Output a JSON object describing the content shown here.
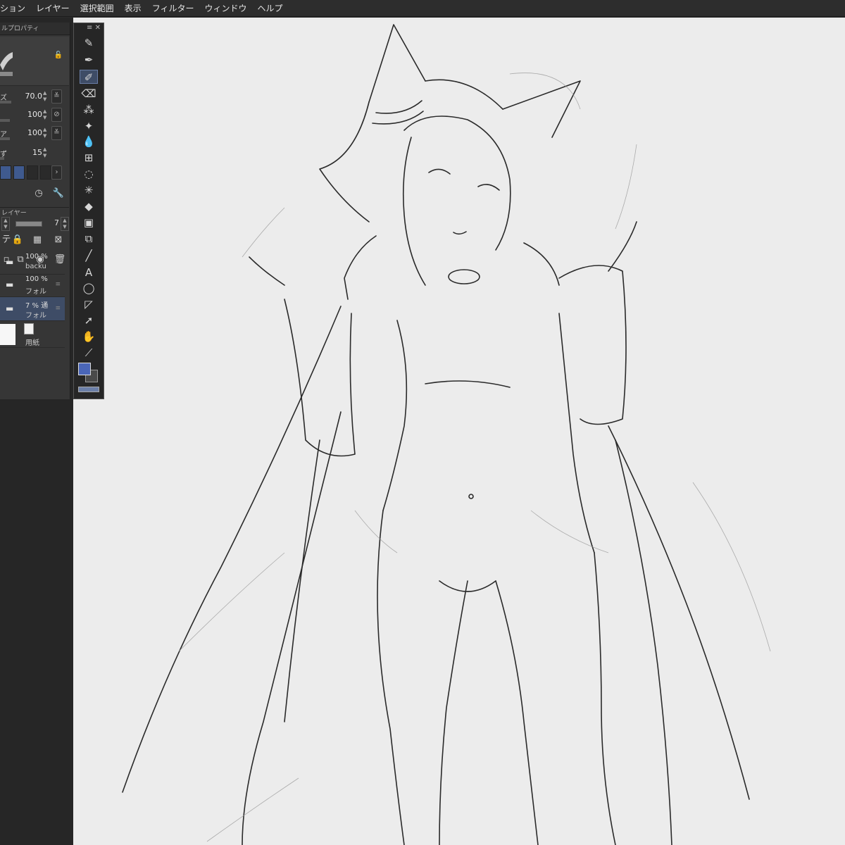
{
  "menu": {
    "items": [
      "ション",
      "レイヤー",
      "選択範囲",
      "表示",
      "フィルター",
      "ウィンドウ",
      "ヘルプ"
    ]
  },
  "tool_property": {
    "title": "ルプロパティ",
    "rows": [
      {
        "label": "ズ",
        "value": "70.0"
      },
      {
        "label": "",
        "value": "100"
      },
      {
        "label": "",
        "value": "100"
      },
      {
        "label": "",
        "value": "15"
      }
    ],
    "swatch_colors": [
      "#3f5a8f",
      "#3f5a8f",
      "#2a2a2a",
      "#2a2a2a"
    ]
  },
  "layer_panel": {
    "title": "レイヤー",
    "opacity_value": "7",
    "layers": [
      {
        "percent": "100 %",
        "name": "backup",
        "type": "folder",
        "selected": false
      },
      {
        "percent": "100 %",
        "name": "フォルダ",
        "type": "folder",
        "selected": false
      },
      {
        "percent": "7 % 通",
        "name": "フォルダ",
        "type": "folder",
        "selected": true
      }
    ],
    "paper": {
      "name": "用紙"
    }
  },
  "toolbar": {
    "tools": [
      {
        "name": "pencil",
        "glyph": "✎"
      },
      {
        "name": "pen",
        "glyph": "✒"
      },
      {
        "name": "g-pen",
        "glyph": "✐",
        "active": true
      },
      {
        "name": "eraser",
        "glyph": "⌫"
      },
      {
        "name": "airbrush",
        "glyph": "⁂"
      },
      {
        "name": "decoration",
        "glyph": "✦"
      },
      {
        "name": "blend",
        "glyph": "💧"
      },
      {
        "name": "mesh",
        "glyph": "⊞"
      },
      {
        "name": "lasso",
        "glyph": "◌"
      },
      {
        "name": "auto-select",
        "glyph": "✳"
      },
      {
        "name": "fill",
        "glyph": "◆"
      },
      {
        "name": "gradient",
        "glyph": "▣"
      },
      {
        "name": "layer-move",
        "glyph": "⧉"
      },
      {
        "name": "line",
        "glyph": "╱"
      },
      {
        "name": "text",
        "glyph": "A"
      },
      {
        "name": "balloon",
        "glyph": "◯"
      },
      {
        "name": "ruler",
        "glyph": "◸"
      },
      {
        "name": "object",
        "glyph": "➚"
      },
      {
        "name": "hand",
        "glyph": "✋"
      },
      {
        "name": "eyedropper",
        "glyph": "⟋"
      }
    ],
    "fg_color": "#4a66b8",
    "bg_color": "#4a4a4a"
  }
}
